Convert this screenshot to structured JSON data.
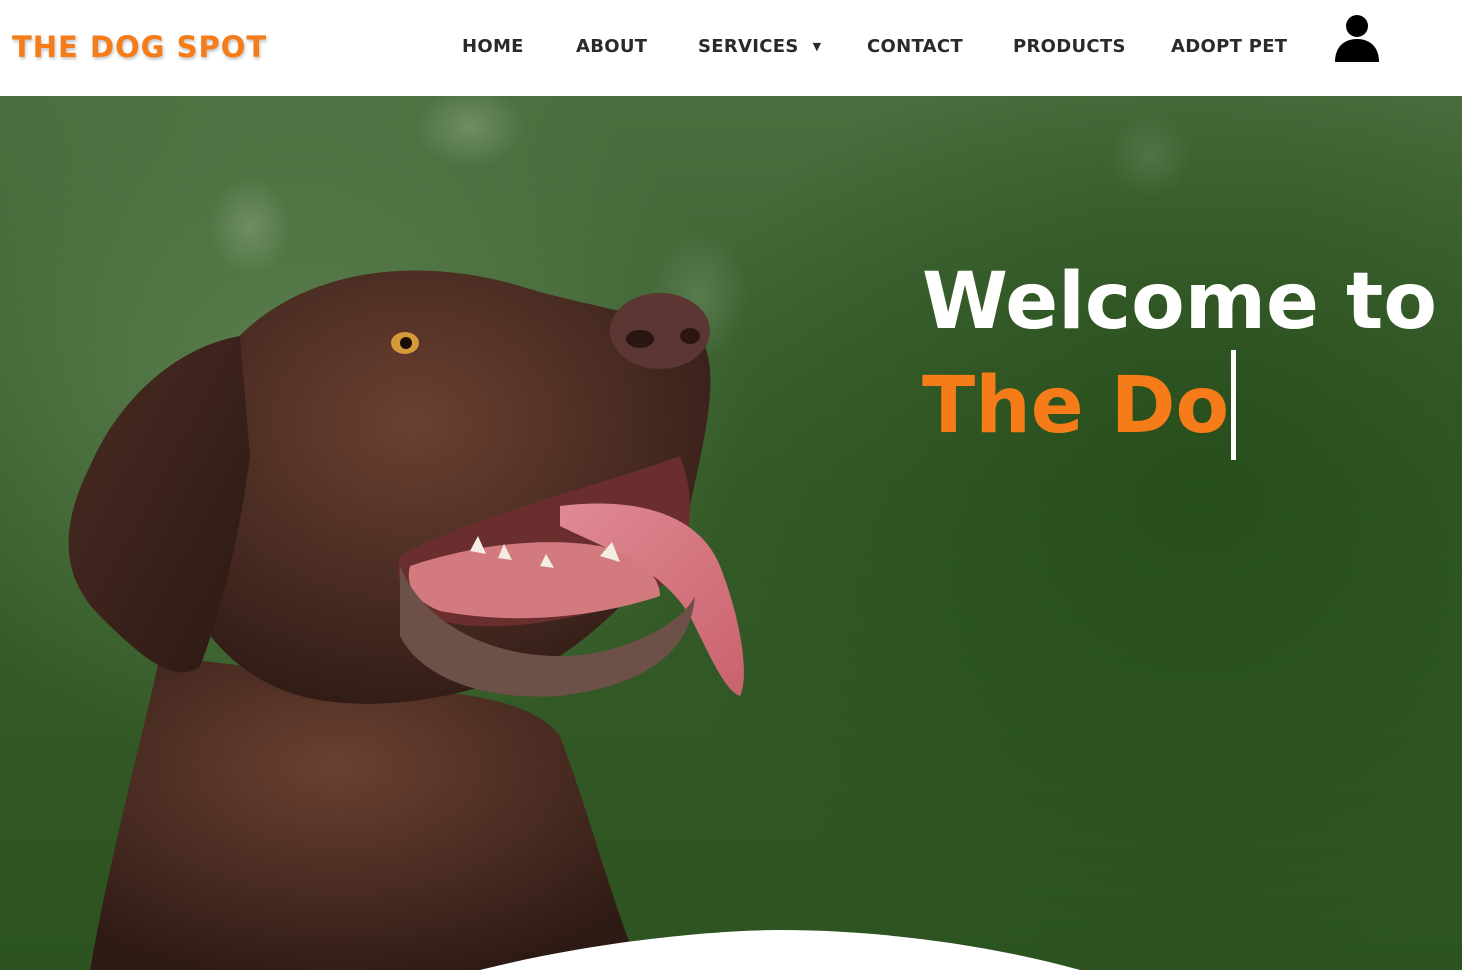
{
  "brand": {
    "name": "THE DOG SPOT",
    "accent_color": "#f57c18"
  },
  "nav": {
    "items": [
      {
        "label": "HOME"
      },
      {
        "label": "ABOUT"
      },
      {
        "label": "SERVICES",
        "has_dropdown": true
      },
      {
        "label": "CONTACT"
      },
      {
        "label": "PRODUCTS"
      },
      {
        "label": "ADOPT PET"
      }
    ],
    "caret": "▼",
    "user_icon": "user-icon"
  },
  "hero": {
    "title": "Welcome to",
    "typed_text": "The Do",
    "image": "chocolate-labrador-photo"
  }
}
